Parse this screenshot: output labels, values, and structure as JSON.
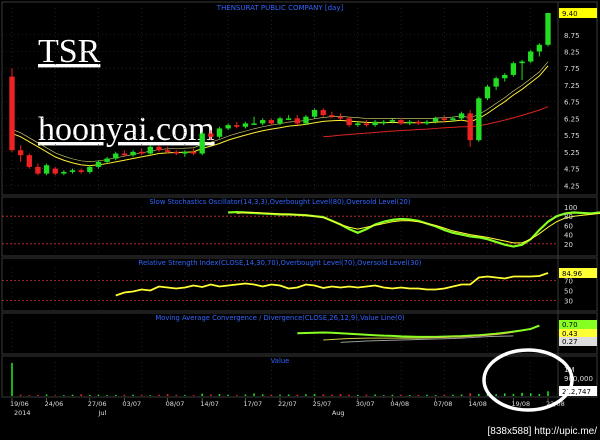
{
  "title": "THENSURAT PUBLIC COMPANY [day]",
  "watermark": {
    "ticker": "TSR",
    "site": "hoonyai.com"
  },
  "footer_credit": "[838x588] http://upic.me/",
  "colors": {
    "background": "#000000",
    "up_candle": "#22dd22",
    "down_candle": "#ee2222",
    "title_text": "#3366ff",
    "price_label_bg": "#ffff00",
    "ind_green": "#88ff22",
    "ind_yellow": "#ffff33",
    "ma_short": "#ffee33",
    "ma_long": "#dd2222",
    "level_line": "#cc3333",
    "grid": "#333333",
    "label_box_green": "#88ff22"
  },
  "chart_data": [
    {
      "type": "candlestick",
      "panel": "price",
      "title": "THENSURAT PUBLIC COMPANY [day]",
      "y_ticks": [
        4.25,
        4.75,
        5.25,
        5.75,
        6.25,
        6.75,
        7.25,
        7.75,
        8.25,
        8.75
      ],
      "last_price_label": "9.40",
      "ylim": [
        4.05,
        9.55
      ],
      "candles": [
        {
          "o": 7.5,
          "h": 7.75,
          "l": 5.25,
          "c": 5.3
        },
        {
          "o": 5.3,
          "h": 5.45,
          "l": 4.95,
          "c": 5.15
        },
        {
          "o": 5.15,
          "h": 5.2,
          "l": 4.75,
          "c": 4.8
        },
        {
          "o": 4.8,
          "h": 4.9,
          "l": 4.55,
          "c": 4.6
        },
        {
          "o": 4.6,
          "h": 4.9,
          "l": 4.55,
          "c": 4.85
        },
        {
          "o": 4.75,
          "h": 4.8,
          "l": 4.55,
          "c": 4.6
        },
        {
          "o": 4.6,
          "h": 4.7,
          "l": 4.55,
          "c": 4.65
        },
        {
          "o": 4.65,
          "h": 4.75,
          "l": 4.6,
          "c": 4.7
        },
        {
          "o": 4.7,
          "h": 4.75,
          "l": 4.6,
          "c": 4.65
        },
        {
          "o": 4.65,
          "h": 4.85,
          "l": 4.6,
          "c": 4.8
        },
        {
          "o": 4.8,
          "h": 5.0,
          "l": 4.75,
          "c": 4.95
        },
        {
          "o": 4.95,
          "h": 5.1,
          "l": 4.9,
          "c": 5.05
        },
        {
          "o": 5.05,
          "h": 5.25,
          "l": 5.0,
          "c": 5.2
        },
        {
          "o": 5.2,
          "h": 5.3,
          "l": 5.1,
          "c": 5.15
        },
        {
          "o": 5.15,
          "h": 5.3,
          "l": 5.1,
          "c": 5.25
        },
        {
          "o": 5.25,
          "h": 5.35,
          "l": 5.15,
          "c": 5.2
        },
        {
          "o": 5.2,
          "h": 5.45,
          "l": 5.15,
          "c": 5.4
        },
        {
          "o": 5.4,
          "h": 5.45,
          "l": 5.25,
          "c": 5.3
        },
        {
          "o": 5.3,
          "h": 5.4,
          "l": 5.2,
          "c": 5.25
        },
        {
          "o": 5.25,
          "h": 5.3,
          "l": 5.15,
          "c": 5.2
        },
        {
          "o": 5.2,
          "h": 5.3,
          "l": 5.1,
          "c": 5.25
        },
        {
          "o": 5.25,
          "h": 5.35,
          "l": 5.15,
          "c": 5.2
        },
        {
          "o": 5.2,
          "h": 5.85,
          "l": 5.15,
          "c": 5.8
        },
        {
          "o": 5.8,
          "h": 5.9,
          "l": 5.6,
          "c": 5.7
        },
        {
          "o": 5.7,
          "h": 6.0,
          "l": 5.65,
          "c": 5.95
        },
        {
          "o": 5.95,
          "h": 6.1,
          "l": 5.9,
          "c": 6.05
        },
        {
          "o": 6.05,
          "h": 6.15,
          "l": 5.95,
          "c": 6.0
        },
        {
          "o": 6.0,
          "h": 6.15,
          "l": 5.95,
          "c": 6.1
        },
        {
          "o": 6.1,
          "h": 6.3,
          "l": 6.05,
          "c": 6.1
        },
        {
          "o": 6.1,
          "h": 6.25,
          "l": 6.05,
          "c": 6.2
        },
        {
          "o": 6.2,
          "h": 6.25,
          "l": 6.05,
          "c": 6.1
        },
        {
          "o": 6.1,
          "h": 6.3,
          "l": 6.05,
          "c": 6.25
        },
        {
          "o": 6.25,
          "h": 6.35,
          "l": 6.2,
          "c": 6.25
        },
        {
          "o": 6.25,
          "h": 6.35,
          "l": 6.05,
          "c": 6.1
        },
        {
          "o": 6.1,
          "h": 6.35,
          "l": 6.05,
          "c": 6.3
        },
        {
          "o": 6.3,
          "h": 6.55,
          "l": 6.25,
          "c": 6.5
        },
        {
          "o": 6.5,
          "h": 6.55,
          "l": 6.3,
          "c": 6.35
        },
        {
          "o": 6.35,
          "h": 6.45,
          "l": 6.25,
          "c": 6.3
        },
        {
          "o": 6.3,
          "h": 6.4,
          "l": 6.2,
          "c": 6.25
        },
        {
          "o": 6.25,
          "h": 6.3,
          "l": 6.0,
          "c": 6.05
        },
        {
          "o": 6.05,
          "h": 6.15,
          "l": 6.0,
          "c": 6.1
        },
        {
          "o": 6.1,
          "h": 6.2,
          "l": 6.0,
          "c": 6.05
        },
        {
          "o": 6.05,
          "h": 6.2,
          "l": 6.0,
          "c": 6.15
        },
        {
          "o": 6.15,
          "h": 6.2,
          "l": 6.05,
          "c": 6.15
        },
        {
          "o": 6.15,
          "h": 6.25,
          "l": 6.1,
          "c": 6.2
        },
        {
          "o": 6.2,
          "h": 6.25,
          "l": 6.05,
          "c": 6.1
        },
        {
          "o": 6.1,
          "h": 6.2,
          "l": 6.05,
          "c": 6.15
        },
        {
          "o": 6.15,
          "h": 6.2,
          "l": 6.05,
          "c": 6.1
        },
        {
          "o": 6.1,
          "h": 6.2,
          "l": 6.05,
          "c": 6.15
        },
        {
          "o": 6.15,
          "h": 6.3,
          "l": 6.1,
          "c": 6.25
        },
        {
          "o": 6.25,
          "h": 6.35,
          "l": 6.15,
          "c": 6.2
        },
        {
          "o": 6.2,
          "h": 6.3,
          "l": 6.15,
          "c": 6.25
        },
        {
          "o": 6.25,
          "h": 6.45,
          "l": 6.2,
          "c": 6.4
        },
        {
          "o": 6.4,
          "h": 6.5,
          "l": 5.4,
          "c": 5.6
        },
        {
          "o": 5.6,
          "h": 6.9,
          "l": 5.55,
          "c": 6.85
        },
        {
          "o": 6.85,
          "h": 7.25,
          "l": 6.8,
          "c": 7.2
        },
        {
          "o": 7.2,
          "h": 7.5,
          "l": 7.1,
          "c": 7.45
        },
        {
          "o": 7.45,
          "h": 7.6,
          "l": 7.35,
          "c": 7.55
        },
        {
          "o": 7.55,
          "h": 7.95,
          "l": 7.5,
          "c": 7.9
        },
        {
          "o": 7.9,
          "h": 8.0,
          "l": 7.4,
          "c": 7.95
        },
        {
          "o": 7.95,
          "h": 8.3,
          "l": 7.9,
          "c": 8.25
        },
        {
          "o": 8.25,
          "h": 8.5,
          "l": 8.1,
          "c": 8.45
        },
        {
          "o": 8.45,
          "h": 9.4,
          "l": 8.4,
          "c": 9.4
        }
      ],
      "ma_short": [
        5.8,
        5.7,
        5.55,
        5.4,
        5.25,
        5.1,
        5.0,
        4.92,
        4.86,
        4.84,
        4.86,
        4.9,
        4.95,
        5.0,
        5.05,
        5.1,
        5.15,
        5.2,
        5.22,
        5.23,
        5.24,
        5.25,
        5.35,
        5.42,
        5.5,
        5.6,
        5.68,
        5.75,
        5.82,
        5.88,
        5.93,
        5.97,
        6.02,
        6.04,
        6.07,
        6.12,
        6.16,
        6.18,
        6.19,
        6.17,
        6.15,
        6.13,
        6.12,
        6.12,
        6.13,
        6.12,
        6.12,
        6.12,
        6.12,
        6.14,
        6.15,
        6.17,
        6.2,
        6.15,
        6.25,
        6.4,
        6.58,
        6.75,
        6.95,
        7.12,
        7.32,
        7.52,
        7.82
      ],
      "ma_long": [
        null,
        null,
        null,
        null,
        null,
        null,
        null,
        null,
        null,
        null,
        null,
        null,
        null,
        null,
        null,
        null,
        null,
        null,
        null,
        null,
        null,
        null,
        null,
        null,
        null,
        null,
        null,
        null,
        null,
        null,
        null,
        null,
        null,
        null,
        null,
        null,
        5.7,
        5.72,
        5.75,
        5.77,
        5.79,
        5.81,
        5.83,
        5.85,
        5.87,
        5.89,
        5.9,
        5.92,
        5.93,
        5.95,
        5.97,
        5.98,
        6.0,
        6.0,
        6.03,
        6.08,
        6.14,
        6.2,
        6.27,
        6.34,
        6.42,
        6.5,
        6.6
      ]
    },
    {
      "type": "line",
      "panel": "stochastic",
      "title": "Slow Stochastics Oscillator(14,3,3),Overbought Level(80),Oversold Level(20)",
      "y_ticks": [
        100,
        80,
        60,
        40,
        20
      ],
      "levels": [
        80,
        20
      ],
      "ylim": [
        0,
        100
      ],
      "series": [
        {
          "color_key": "ind_green",
          "start": 25,
          "values": [
            88,
            89,
            88,
            87,
            86,
            85,
            84,
            84,
            83,
            82,
            80,
            78,
            70,
            62,
            52,
            44,
            52,
            62,
            68,
            72,
            74,
            73,
            70,
            64,
            58,
            50,
            44,
            40,
            36,
            34,
            30,
            24,
            18,
            14,
            18,
            30,
            50,
            68,
            80,
            86,
            88,
            87,
            86,
            88,
            89,
            92,
            95
          ]
        },
        {
          "color_key": "ind_yellow",
          "start": 26,
          "values": [
            86,
            88,
            88,
            87,
            86,
            85,
            84,
            83,
            82,
            80,
            77,
            70,
            62,
            56,
            52,
            56,
            60,
            64,
            68,
            70,
            70,
            68,
            64,
            60,
            54,
            48,
            44,
            40,
            37,
            34,
            30,
            26,
            22,
            22,
            30,
            42,
            56,
            68,
            76,
            80,
            82,
            84,
            86,
            88,
            90
          ]
        }
      ]
    },
    {
      "type": "line",
      "panel": "rsi",
      "title": "Relative Strength Index(CLOSE,14,30,70),Overbought Level(70),Oversold Level(30)",
      "y_ticks": [
        70,
        50,
        30
      ],
      "label_box": "84.96",
      "levels": [
        70,
        30
      ],
      "ylim": [
        15,
        95
      ],
      "series": [
        {
          "color_key": "ind_yellow",
          "start": 12,
          "values": [
            40,
            46,
            48,
            52,
            50,
            58,
            56,
            54,
            56,
            60,
            57,
            62,
            58,
            60,
            62,
            64,
            62,
            58,
            62,
            60,
            54,
            56,
            62,
            60,
            55,
            58,
            56,
            58,
            56,
            58,
            60,
            56,
            54,
            56,
            54,
            54,
            52,
            52,
            54,
            58,
            62,
            62,
            76,
            78,
            76,
            74,
            78,
            78,
            78,
            79,
            85
          ]
        }
      ]
    },
    {
      "type": "line",
      "panel": "macd",
      "title": "Moving Average Convergence / Divergence(CLOSE,26,12,9),Value Line(0)",
      "labels": [
        "0.70",
        "0.43",
        "0.27"
      ],
      "ylim": [
        -0.4,
        0.85
      ],
      "series": [
        {
          "color_key": "ind_green",
          "start": 33,
          "values": [
            0.38,
            0.39,
            0.4,
            0.41,
            0.4,
            0.38,
            0.36,
            0.34,
            0.32,
            0.3,
            0.28,
            0.27,
            0.25,
            0.24,
            0.23,
            0.23,
            0.23,
            0.24,
            0.25,
            0.26,
            0.28,
            0.3,
            0.33,
            0.36,
            0.4,
            0.45,
            0.5,
            0.56,
            0.7
          ]
        },
        {
          "color_key": "ind_yellow",
          "start": 36,
          "values": [
            0.1,
            0.12,
            0.14,
            0.16,
            0.17,
            0.18,
            0.18,
            0.18,
            0.18,
            0.18,
            0.18,
            0.18,
            0.19,
            0.2,
            0.21,
            0.22,
            0.23,
            0.25,
            0.27,
            0.3,
            0.33,
            0.37,
            0.43
          ]
        },
        {
          "color_key": "grey",
          "start": 38,
          "values": [
            0.0,
            0.02,
            0.04,
            0.06,
            0.07,
            0.08,
            0.09,
            0.1,
            0.11,
            0.12,
            0.13,
            0.14,
            0.15,
            0.16,
            0.18,
            0.2,
            0.22,
            0.24,
            0.25,
            0.26,
            0.27
          ]
        }
      ]
    },
    {
      "type": "bar",
      "panel": "value",
      "title": "Value",
      "y_ticks": [
        "1M",
        "900,000"
      ],
      "label_box": "222,747",
      "ylim": [
        0,
        1600000
      ],
      "values": [
        1550000,
        60000,
        40000,
        50000,
        70000,
        30000,
        40000,
        60000,
        80000,
        50000,
        60000,
        45000,
        50000,
        55000,
        60000,
        45000,
        40000,
        55000,
        90000,
        50000,
        40000,
        40000,
        110000,
        70000,
        90000,
        60000,
        40000,
        70000,
        120000,
        80000,
        50000,
        60000,
        70000,
        60000,
        80000,
        100000,
        70000,
        60000,
        90000,
        60000,
        50000,
        60000,
        70000,
        40000,
        60000,
        55000,
        45000,
        50000,
        60000,
        40000,
        55000,
        60000,
        70000,
        130000,
        90000,
        110000,
        80000,
        120000,
        100000,
        150000,
        130000,
        90000,
        222747
      ],
      "colors": [
        "up",
        "down",
        "down",
        "down",
        "up",
        "down",
        "up",
        "up",
        "down",
        "up",
        "up",
        "up",
        "up",
        "down",
        "up",
        "down",
        "up",
        "down",
        "down",
        "down",
        "up",
        "down",
        "up",
        "down",
        "up",
        "up",
        "down",
        "up",
        "up",
        "up",
        "down",
        "up",
        "up",
        "down",
        "up",
        "up",
        "down",
        "down",
        "down",
        "down",
        "up",
        "down",
        "up",
        "up",
        "up",
        "down",
        "up",
        "down",
        "up",
        "up",
        "down",
        "up",
        "up",
        "down",
        "up",
        "up",
        "up",
        "up",
        "up",
        "up",
        "up",
        "up",
        "up"
      ]
    }
  ],
  "x_axis": {
    "dates": [
      "19/06",
      "24/06",
      "27/06",
      "03/07",
      "08/07",
      "14/07",
      "17/07",
      "22/07",
      "25/07",
      "30/07",
      "04/08",
      "07/08",
      "14/08",
      "19/08",
      "22/08"
    ],
    "year": "2014",
    "months": [
      "Jul",
      "Aug"
    ]
  }
}
